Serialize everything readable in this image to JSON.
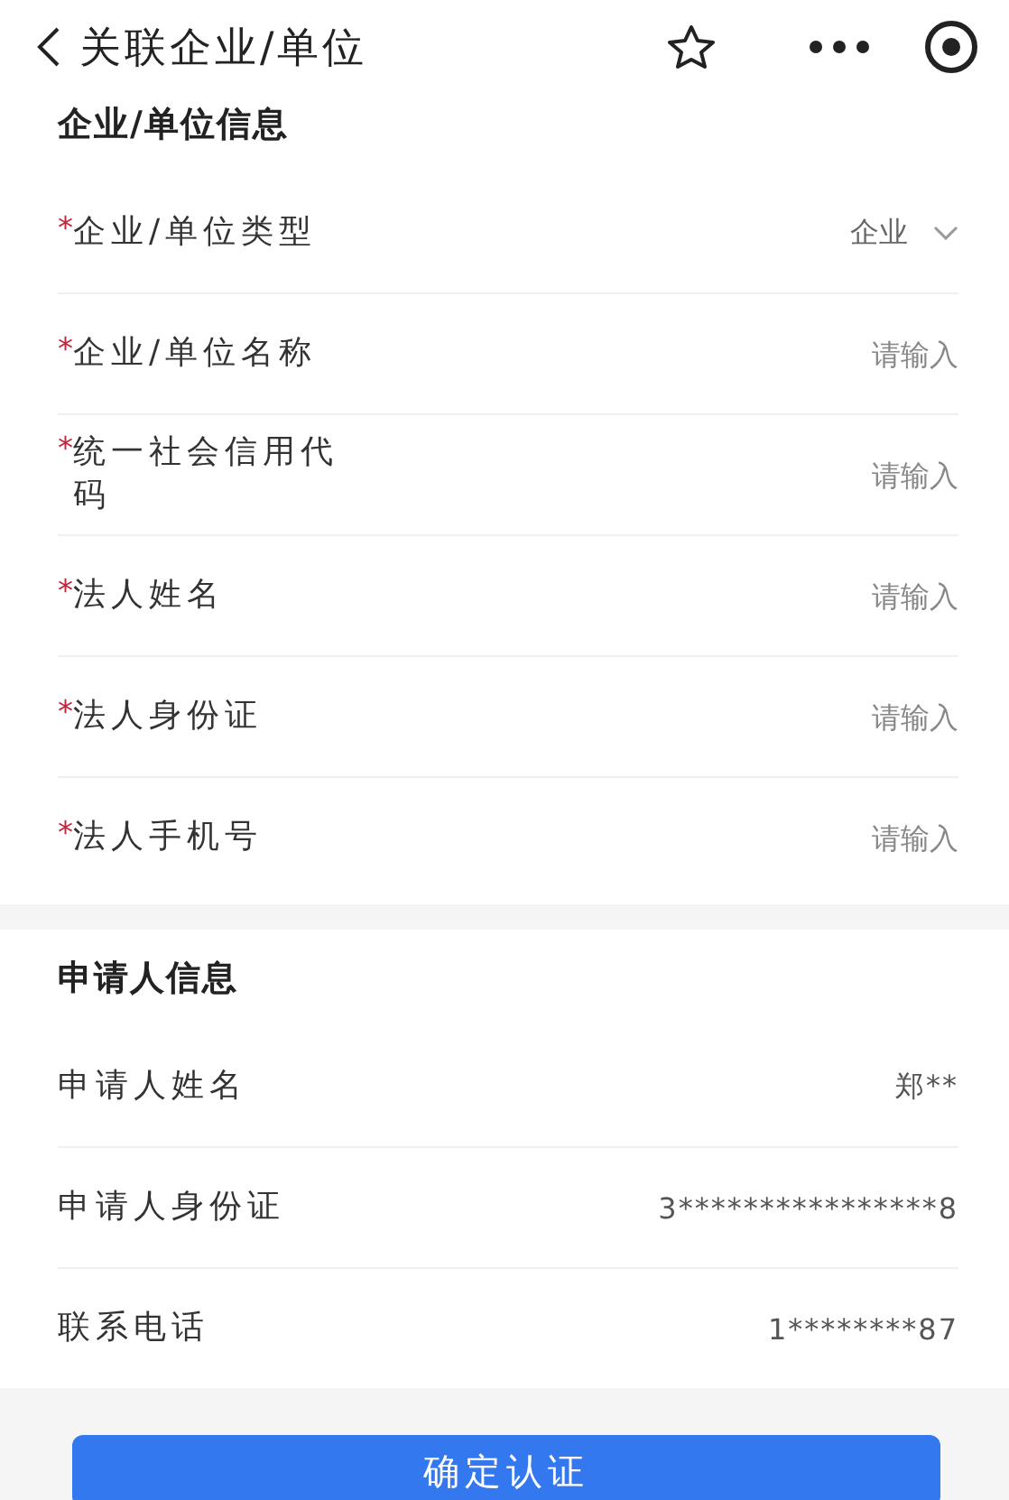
{
  "header": {
    "title": "关联企业/单位"
  },
  "company_section": {
    "title": "企业/单位信息",
    "fields": [
      {
        "kind": "select",
        "required_mark": "*",
        "label": "企业/单位类型",
        "value": "企业"
      },
      {
        "kind": "input",
        "required_mark": "*",
        "label": "企业/单位名称",
        "placeholder": "请输入"
      },
      {
        "kind": "input",
        "required_mark": "*",
        "label": "统一社会信用代码",
        "placeholder": "请输入"
      },
      {
        "kind": "input",
        "required_mark": "*",
        "label": "法人姓名",
        "placeholder": "请输入"
      },
      {
        "kind": "input",
        "required_mark": "*",
        "label": "法人身份证",
        "placeholder": "请输入"
      },
      {
        "kind": "input",
        "required_mark": "*",
        "label": "法人手机号",
        "placeholder": "请输入"
      }
    ]
  },
  "applicant_section": {
    "title": "申请人信息",
    "fields": [
      {
        "label": "申请人姓名",
        "value": "郑**"
      },
      {
        "label": "申请人身份证",
        "value": "3****************8"
      },
      {
        "label": "联系电话",
        "value": "1********87"
      }
    ]
  },
  "submit_button": {
    "label": "确定认证"
  }
}
